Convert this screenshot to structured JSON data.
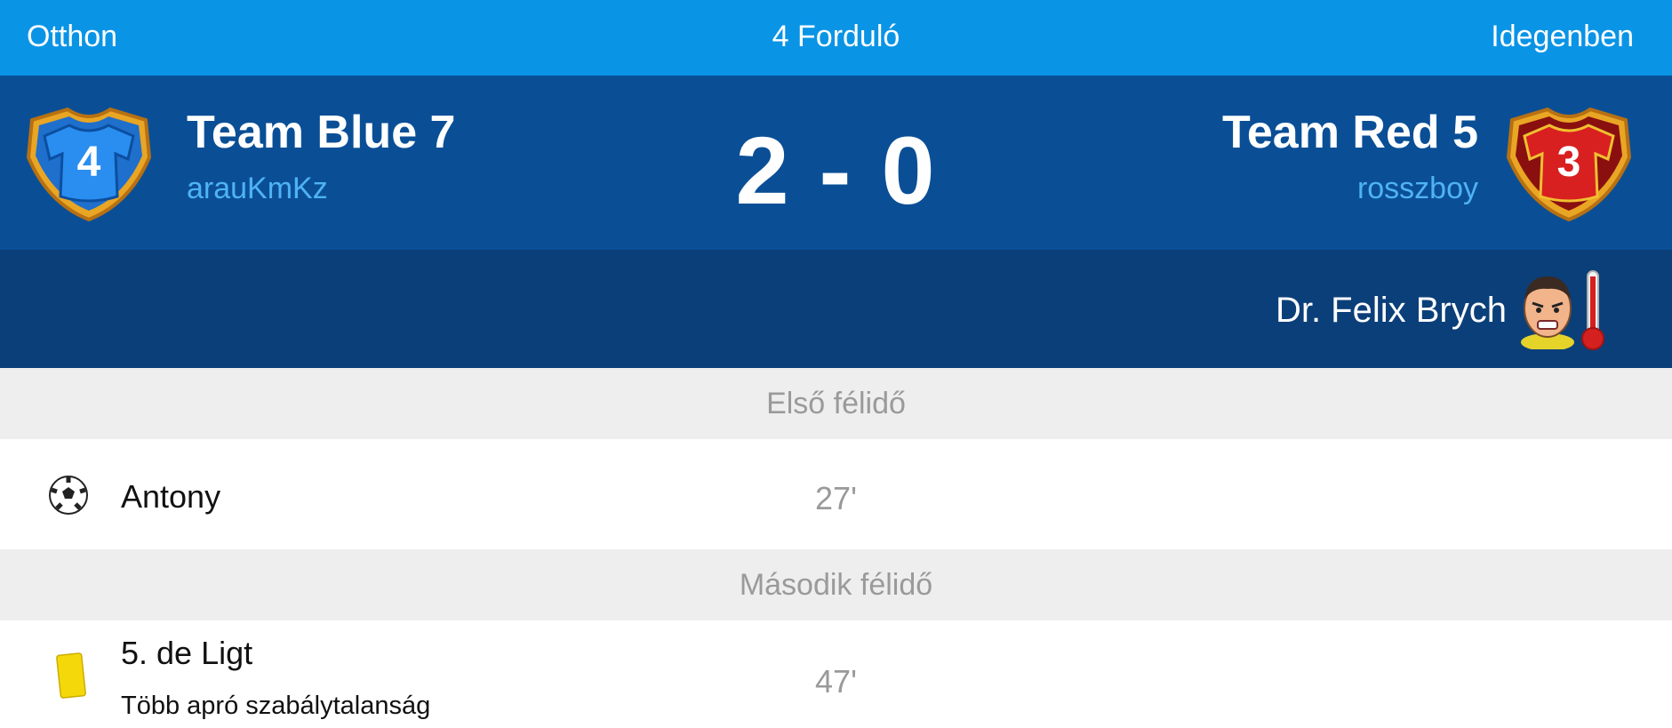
{
  "header": {
    "home_label": "Otthon",
    "round_label": "4 Forduló",
    "away_label": "Idegenben"
  },
  "home_team": {
    "name": "Team Blue 7",
    "user": "arauKmKz",
    "badge_number": "4",
    "badge_icon": "blue-jersey-icon",
    "color": "#1a8fe0"
  },
  "away_team": {
    "name": "Team Red 5",
    "user": "rosszboy",
    "badge_number": "3",
    "badge_icon": "red-jersey-icon",
    "color": "#d01f1f"
  },
  "score": "2 - 0",
  "referee": {
    "name": "Dr. Felix Brych",
    "icon": "referee-face-icon",
    "temperament_icon": "thermometer-icon"
  },
  "halves": [
    {
      "title": "Első félidő",
      "events": [
        {
          "type": "goal",
          "icon": "soccer-ball-icon",
          "player": "Antony",
          "minute": "27'"
        }
      ]
    },
    {
      "title": "Második félidő",
      "events": [
        {
          "type": "yellow-card",
          "icon": "yellow-card-icon",
          "player": "5. de Ligt",
          "reason": "Több apró szabálytalanság",
          "minute": "47'"
        }
      ]
    }
  ],
  "colors": {
    "top_bar": "#0a94e6",
    "score_panel": "#0a4f96",
    "referee_panel": "#0b3f79",
    "section_header": "#eeeeee",
    "username": "#4fb2f5",
    "minute_text": "#9a9a9a"
  }
}
